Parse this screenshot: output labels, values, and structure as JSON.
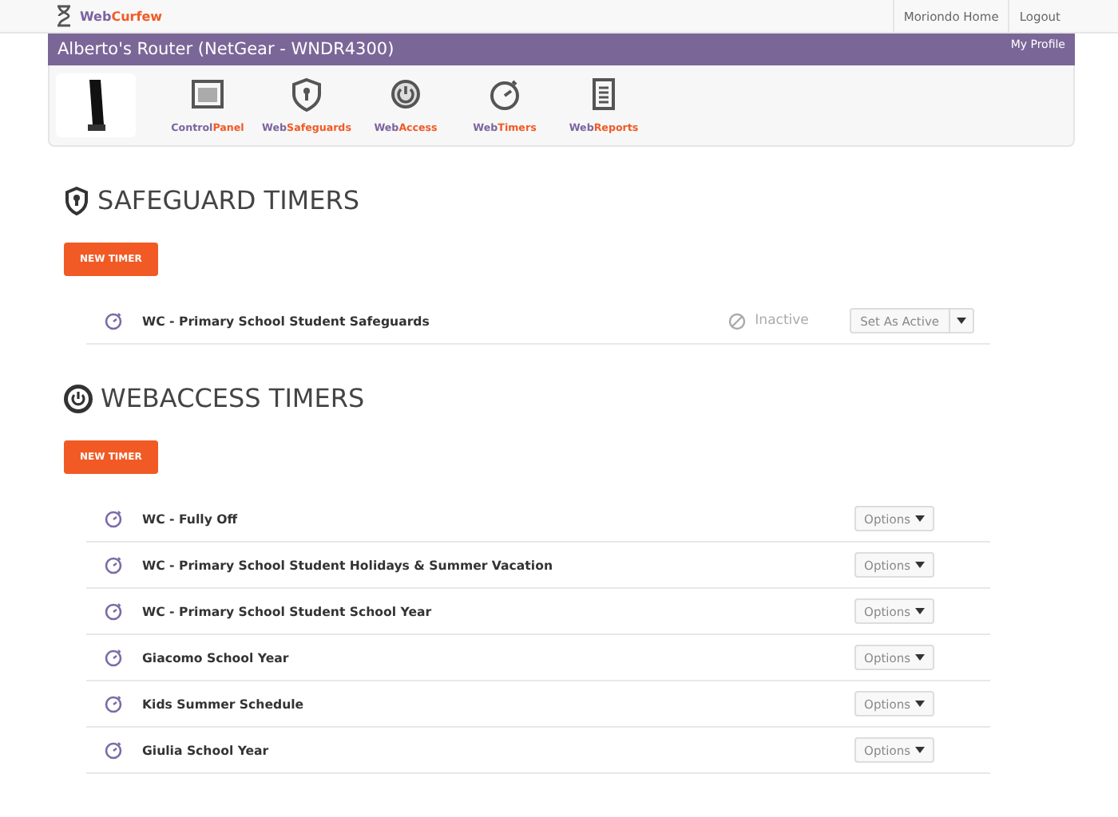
{
  "topbar": {
    "logo": {
      "first": "Web",
      "second": "Curfew"
    },
    "links": [
      "Moriondo Home",
      "Logout"
    ]
  },
  "router": {
    "title": "Alberto's Router (NetGear - WNDR4300)",
    "profile_link": "My Profile"
  },
  "nav": [
    {
      "kind": "panel",
      "first": "Control",
      "second": "Panel"
    },
    {
      "kind": "safeguards",
      "first": "Web",
      "second": "Safeguards"
    },
    {
      "kind": "access",
      "first": "Web",
      "second": "Access"
    },
    {
      "kind": "timers",
      "first": "Web",
      "second": "Timers"
    },
    {
      "kind": "reports",
      "first": "Web",
      "second": "Reports"
    }
  ],
  "sections": [
    {
      "kind": "safeguard",
      "title": "SAFEGUARD TIMERS",
      "new_button": "NEW TIMER",
      "rows": [
        {
          "kind": "status",
          "name": "WC - Primary School Student Safeguards",
          "status": "Inactive",
          "action": "Set As Active"
        }
      ]
    },
    {
      "kind": "webaccess",
      "title": "WEBACCESS TIMERS",
      "new_button": "NEW TIMER",
      "rows": [
        {
          "kind": "options",
          "name": "WC - Fully Off",
          "action": "Options"
        },
        {
          "kind": "options",
          "name": "WC - Primary School Student Holidays & Summer Vacation",
          "action": "Options"
        },
        {
          "kind": "options",
          "name": "WC - Primary School Student School Year",
          "action": "Options"
        },
        {
          "kind": "options",
          "name": "Giacomo School Year",
          "action": "Options"
        },
        {
          "kind": "options",
          "name": "Kids Summer Schedule",
          "action": "Options"
        },
        {
          "kind": "options",
          "name": "Giulia School Year",
          "action": "Options"
        }
      ]
    }
  ]
}
